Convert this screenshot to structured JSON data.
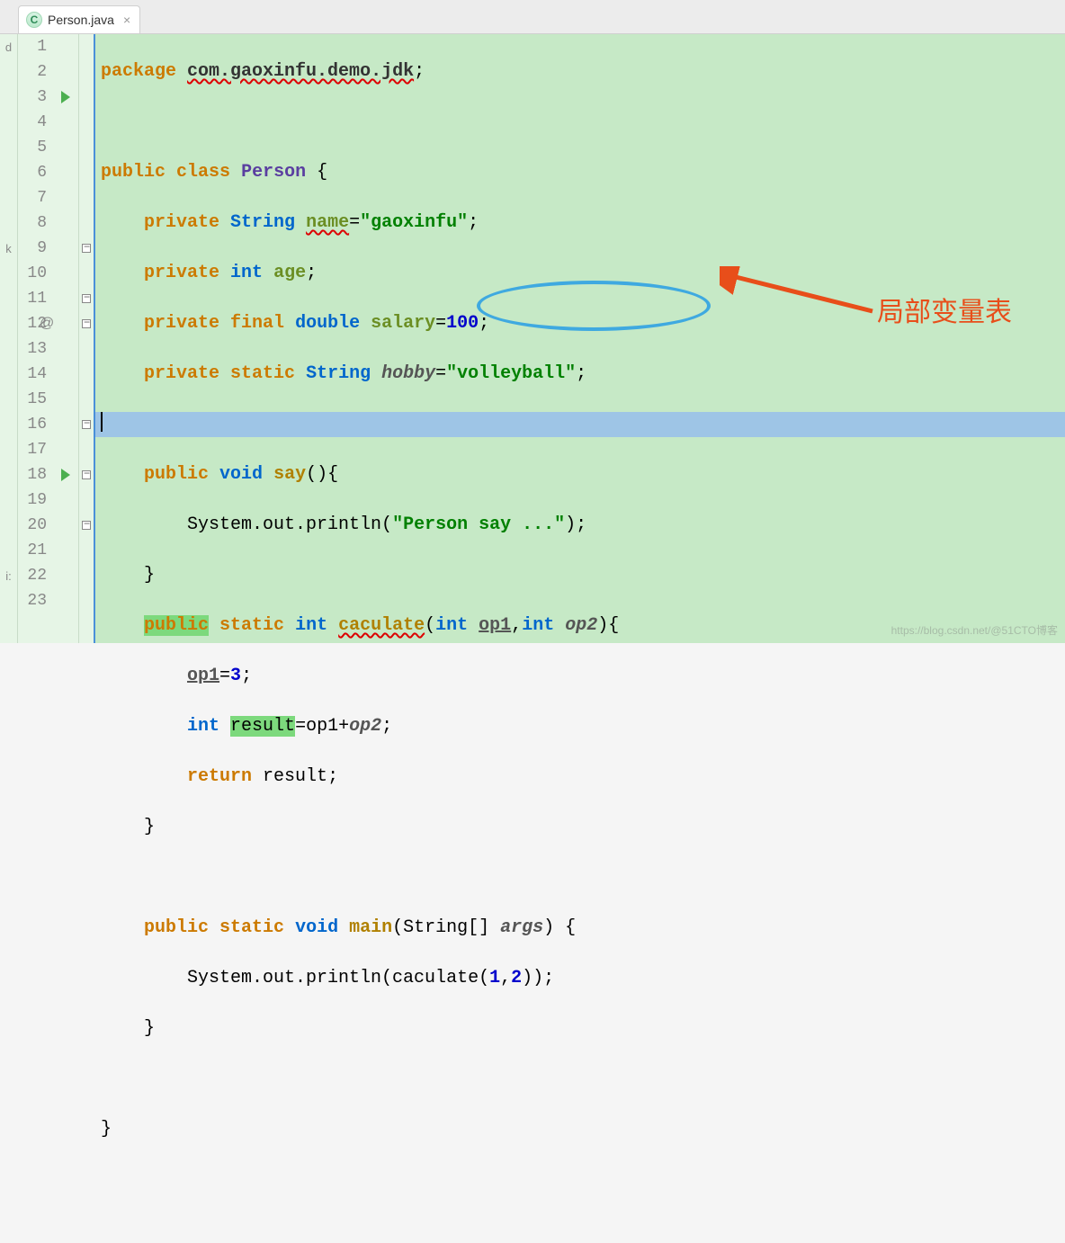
{
  "tab": {
    "filename": "Person.java",
    "icon_letter": "C"
  },
  "gutter": {
    "left_markers": {
      "1": "d",
      "9": "k",
      "22": "i:"
    },
    "lines": [
      "1",
      "2",
      "3",
      "4",
      "5",
      "6",
      "7",
      "8",
      "9",
      "10",
      "11",
      "12",
      "13",
      "14",
      "15",
      "16",
      "17",
      "18",
      "19",
      "20",
      "21",
      "22",
      "23"
    ]
  },
  "code": {
    "l1": {
      "kw": "package",
      "pkg": "com.gaoxinfu.demo.jdk",
      "semi": ";"
    },
    "l3": {
      "kw1": "public",
      "kw2": "class",
      "name": "Person",
      "brace": " {"
    },
    "l4": {
      "kw1": "private",
      "type": "String",
      "fld": "name",
      "eq": "=",
      "str": "\"gaoxinfu\"",
      "semi": ";"
    },
    "l5": {
      "kw1": "private",
      "type": "int",
      "fld": "age",
      "semi": ";"
    },
    "l6": {
      "kw1": "private",
      "kw2": "final",
      "type": "double",
      "fld": "salary",
      "eq": "=",
      "num": "100",
      "semi": ";"
    },
    "l7": {
      "kw1": "private",
      "kw2": "static",
      "type": "String",
      "fld": "hobby",
      "eq": "=",
      "str": "\"volleyball\"",
      "semi": ";"
    },
    "l9": {
      "kw1": "public",
      "type": "void",
      "mth": "say",
      "rest": "(){"
    },
    "l10": {
      "pre": "System.out.println(",
      "str": "\"Person say ...\"",
      "post": ");"
    },
    "l11": {
      "brace": "}"
    },
    "l12": {
      "kw1": "public",
      "kw2": "static",
      "type": "int",
      "mth": "caculate",
      "p1": "(",
      "t1": "int",
      "a1": "op1",
      "comma": ",",
      "t2": "int",
      "a2": "op2",
      "p2": "){"
    },
    "l13": {
      "a": "op1",
      "eq": "=",
      "num": "3",
      "semi": ";"
    },
    "l14": {
      "type": "int",
      "res": "result",
      "eq": "=",
      "a1": "op1",
      "plus": "+",
      "a2": "op2",
      "semi": ";"
    },
    "l15": {
      "kw": "return",
      "res": "result",
      "semi": ";"
    },
    "l16": {
      "brace": "}"
    },
    "l18": {
      "kw1": "public",
      "kw2": "static",
      "type": "void",
      "mth": "main",
      "p": "(String[] ",
      "args": "args",
      "p2": ") {"
    },
    "l19": {
      "pre": "System.out.println(caculate(",
      "n1": "1",
      "c": ",",
      "n2": "2",
      "post": "));"
    },
    "l20": {
      "brace": "}"
    },
    "l22": {
      "brace": "}"
    }
  },
  "annotation": {
    "label": "局部变量表"
  },
  "watermark": "https://blog.csdn.net/@51CTO博客"
}
